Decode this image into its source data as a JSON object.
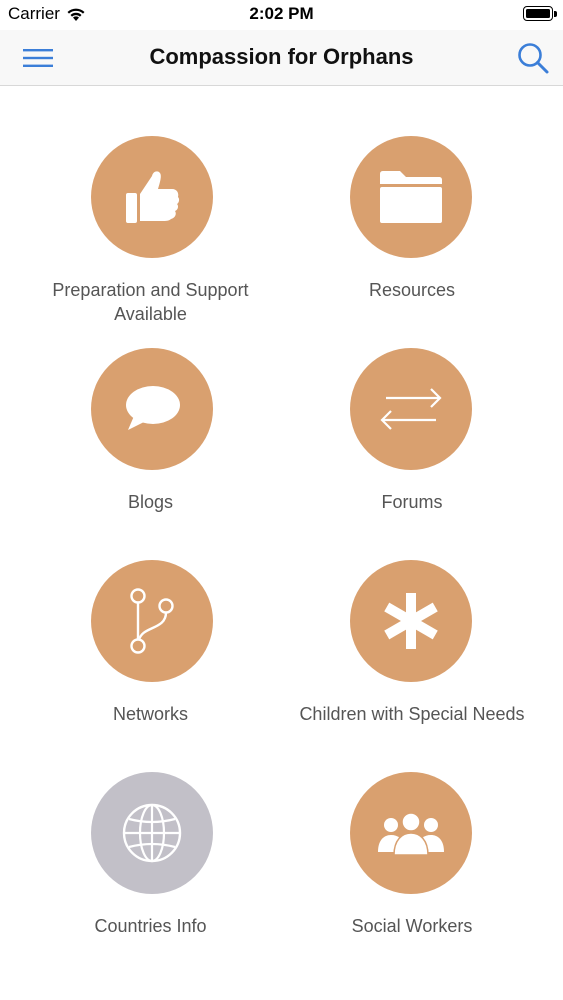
{
  "status_bar": {
    "carrier": "Carrier",
    "time": "2:02 PM",
    "icons": [
      "wifi-icon",
      "battery-icon"
    ]
  },
  "nav": {
    "title": "Compassion for Orphans",
    "left_icon": "hamburger-menu-icon",
    "right_icon": "search-icon"
  },
  "colors": {
    "tile_accent": "#d9a06f",
    "tile_disabled": "#c2c0c8",
    "nav_icon": "#3b7ed8"
  },
  "tiles": [
    {
      "label": "Preparation and Support Available",
      "icon": "thumbs-up-icon"
    },
    {
      "label": "Resources",
      "icon": "folder-icon"
    },
    {
      "label": "Blogs",
      "icon": "speech-bubble-icon"
    },
    {
      "label": "Forums",
      "icon": "exchange-arrows-icon"
    },
    {
      "label": "Networks",
      "icon": "branch-icon"
    },
    {
      "label": "Children with Special Needs",
      "icon": "asterisk-icon"
    },
    {
      "label": "Countries Info",
      "icon": "globe-icon"
    },
    {
      "label": "Social Workers",
      "icon": "users-group-icon"
    }
  ]
}
